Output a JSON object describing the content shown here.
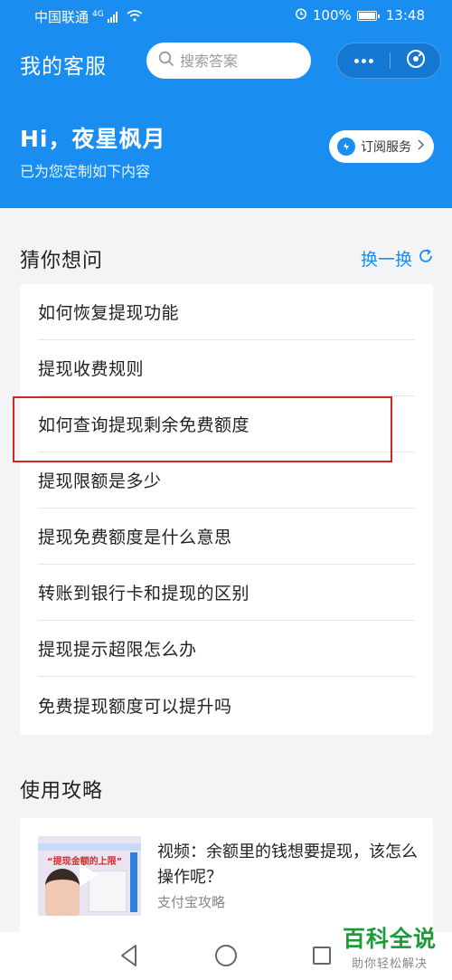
{
  "status_bar": {
    "carrier": "中国联通",
    "network": "4G",
    "battery": "100%",
    "time": "13:48"
  },
  "header": {
    "title": "我的客服",
    "search_placeholder": "搜索答案",
    "greeting": "Hi，夜星枫月",
    "subtitle": "已为您定制如下内容",
    "subscribe_label": "订阅服务",
    "accent_color": "#1a8df0"
  },
  "guess": {
    "title": "猜你想问",
    "refresh_label": "换一换",
    "questions": [
      "如何恢复提现功能",
      "提现收费规则",
      "如何查询提现剩余免费额度",
      "提现限额是多少",
      "提现免费额度是什么意思",
      "转账到银行卡和提现的区别",
      "提现提示超限怎么办",
      "免费提现额度可以提升吗"
    ],
    "highlight_color": "#d42525"
  },
  "guides": {
    "title": "使用攻略",
    "items": [
      {
        "title": "视频：余额里的钱想要提现，该怎么操作呢？",
        "source": "支付宝攻略",
        "thumb_text": "“提现金额的上限”"
      }
    ]
  },
  "watermark": {
    "main": "百科全说",
    "sub": "助你轻松解决"
  }
}
